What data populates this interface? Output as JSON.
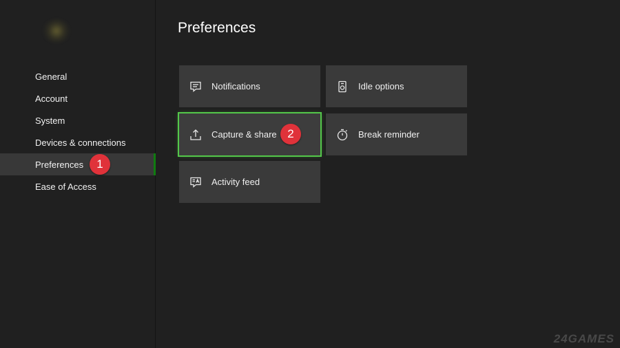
{
  "sidebar": {
    "items": [
      {
        "label": "General"
      },
      {
        "label": "Account"
      },
      {
        "label": "System"
      },
      {
        "label": "Devices & connections"
      },
      {
        "label": "Preferences",
        "selected": true,
        "badge": "1"
      },
      {
        "label": "Ease of Access"
      }
    ]
  },
  "main": {
    "title": "Preferences",
    "tiles": [
      {
        "label": "Notifications",
        "icon": "notifications-icon"
      },
      {
        "label": "Idle options",
        "icon": "idle-options-icon"
      },
      {
        "label": "Capture & share",
        "icon": "upload-share-icon",
        "focused": true,
        "badge": "2"
      },
      {
        "label": "Break reminder",
        "icon": "timer-icon"
      },
      {
        "label": "Activity feed",
        "icon": "activity-feed-icon"
      }
    ]
  },
  "watermark": "24GAMES",
  "colors": {
    "background": "#202020",
    "tile": "#3a3a3a",
    "accent_green": "#107c10",
    "focus_outline": "#54c84a",
    "badge_red": "#e0323a"
  }
}
